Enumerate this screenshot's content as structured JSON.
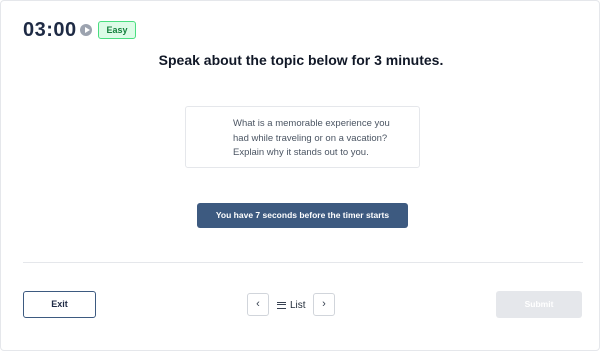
{
  "header": {
    "timer": "03:00",
    "difficulty_badge": "Easy",
    "play_icon": "play-circle-icon"
  },
  "main": {
    "instruction": "Speak about the topic below for 3 minutes.",
    "prompt": "What is a memorable experience you had while traveling or on a vacation? Explain why it stands out to you.",
    "countdown_notice": "You have 7 seconds before the timer starts"
  },
  "footer": {
    "exit_label": "Exit",
    "prev_icon": "chevron-left-icon",
    "prev_glyph": "‹",
    "list_icon": "list-icon",
    "list_label": "List",
    "next_icon": "chevron-right-icon",
    "next_glyph": "›",
    "submit_label": "Submit"
  },
  "colors": {
    "accent": "#3d5a80",
    "badge_border": "#4ade80",
    "badge_background": "#dcfce7",
    "badge_text": "#15803d",
    "submit_disabled": "#e5e7eb"
  }
}
